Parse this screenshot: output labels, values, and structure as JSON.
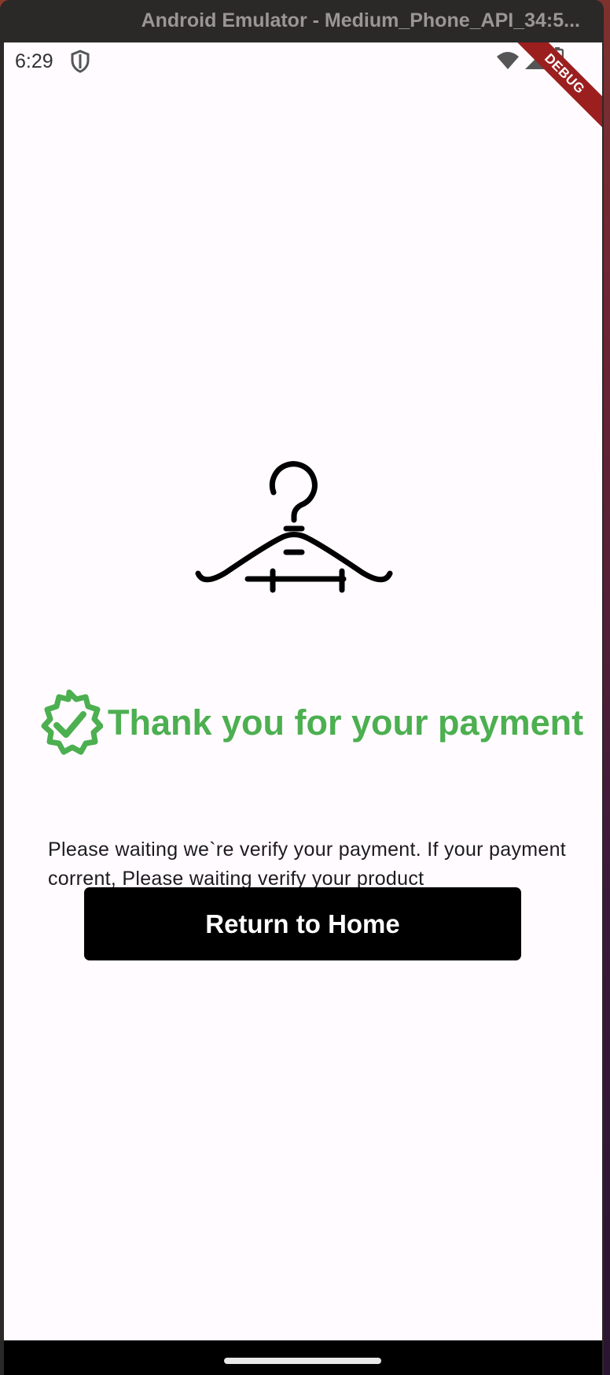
{
  "window": {
    "title": "Android Emulator - Medium_Phone_API_34:5..."
  },
  "status_bar": {
    "time": "6:29",
    "debug_label": "DEBUG"
  },
  "content": {
    "headline": "Thank you for your payment",
    "message": "Please waiting we`re verify your payment. If your payment corrent, Please waiting verify your product",
    "button_label": "Return to Home"
  },
  "colors": {
    "accent_green": "#4caf50",
    "button_bg": "#000000",
    "debug_banner": "#9c1f1f"
  },
  "icons": [
    "shield-icon",
    "wifi-icon",
    "signal-icon",
    "battery-icon",
    "hanger-icon",
    "verified-badge-icon"
  ]
}
